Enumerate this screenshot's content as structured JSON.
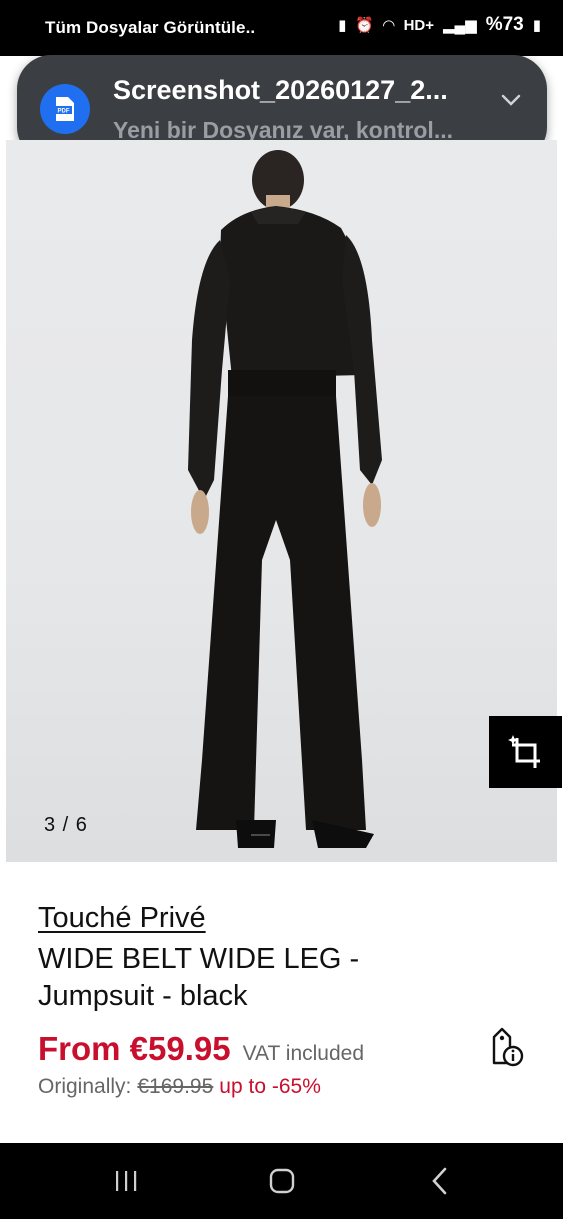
{
  "status_bar": {
    "left_text": "Tüm Dosyalar Görüntüle..",
    "network": "HD+",
    "battery": "%73"
  },
  "notification": {
    "title": "Screenshot_20260127_2...",
    "text": "Yeni bir Dosyanız var, kontrol...",
    "icon_label": "PDF"
  },
  "gallery": {
    "counter": "3 / 6"
  },
  "product": {
    "brand": "Touché Privé",
    "name": "WIDE BELT WIDE LEG - Jumpsuit - black",
    "price_from": "From €59.95",
    "vat": "VAT included",
    "originally_label": "Originally:",
    "original_price": "€169.95",
    "discount": "up to -65%"
  },
  "colors": {
    "sale_red": "#c8102e",
    "notification_bg": "#3b3e42",
    "pdf_blue": "#1f6ff0"
  }
}
